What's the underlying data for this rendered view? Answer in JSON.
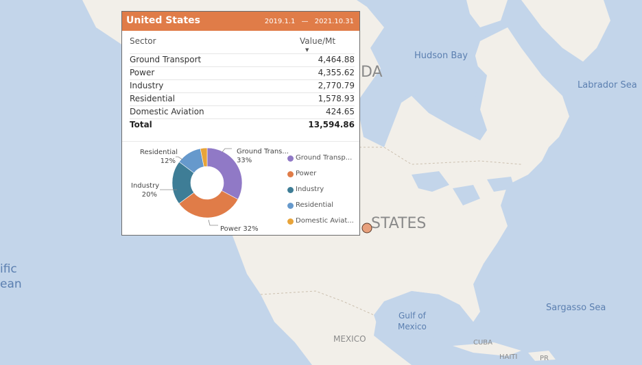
{
  "map": {
    "labels": {
      "hudson_bay": "Hudson Bay",
      "labrador_sea": "Labrador Sea",
      "canada_partial": "DA",
      "united_states_partial": "STATES",
      "pacific_partial_1": "ific",
      "pacific_partial_2": "ean",
      "sargasso_sea": "Sargasso Sea",
      "gulf_of_mexico_1": "Gulf of",
      "gulf_of_mexico_2": "Mexico",
      "mexico": "MEXICO",
      "cuba": "CUBA",
      "haiti": "HAITI",
      "pr": "PR"
    }
  },
  "tooltip": {
    "title": "United States",
    "date_start": "2019.1.1",
    "date_sep": "—",
    "date_end": "2021.10.31",
    "columns": {
      "sector": "Sector",
      "value": "Value/Mt"
    },
    "rows": [
      {
        "sector": "Ground Transport",
        "value": "4,464.88"
      },
      {
        "sector": "Power",
        "value": "4,355.62"
      },
      {
        "sector": "Industry",
        "value": "2,770.79"
      },
      {
        "sector": "Residential",
        "value": "1,578.93"
      },
      {
        "sector": "Domestic Aviation",
        "value": "424.65"
      }
    ],
    "total": {
      "label": "Total",
      "value": "13,594.86"
    }
  },
  "chart_data": {
    "type": "pie",
    "donut": true,
    "categories": [
      "Ground Transport",
      "Power",
      "Industry",
      "Residential",
      "Domestic Aviation"
    ],
    "values": [
      4464.88,
      4355.62,
      2770.79,
      1578.93,
      424.65
    ],
    "colors": [
      "#9079c6",
      "#e07c48",
      "#3e7d96",
      "#6699cc",
      "#e8a43a"
    ],
    "legend": [
      "Ground Transp...",
      "Power",
      "Industry",
      "Residential",
      "Domestic Aviat..."
    ],
    "legend_position": "right",
    "data_labels": {
      "ground": [
        "Ground Trans...",
        "33%"
      ],
      "power": "Power 32%",
      "industry": [
        "Industry",
        "20%"
      ],
      "residential": [
        "Residential",
        "12%"
      ]
    }
  }
}
